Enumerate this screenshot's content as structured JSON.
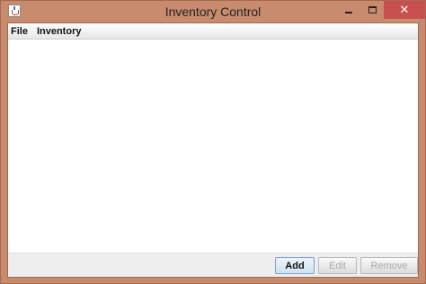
{
  "window": {
    "title": "Inventory Control",
    "close_symbol": "✕"
  },
  "menubar": {
    "items": [
      {
        "label": "File"
      },
      {
        "label": "Inventory"
      }
    ]
  },
  "buttons": {
    "add_label": "Add",
    "edit_label": "Edit",
    "remove_label": "Remove"
  },
  "icons": {
    "app": "java-cup-icon",
    "minimize": "minimize-icon",
    "maximize": "maximize-icon",
    "close": "close-icon"
  },
  "colors": {
    "frame": "#c98b6e",
    "close_button": "#c7504f",
    "default_button_border": "#7ba3cc"
  }
}
